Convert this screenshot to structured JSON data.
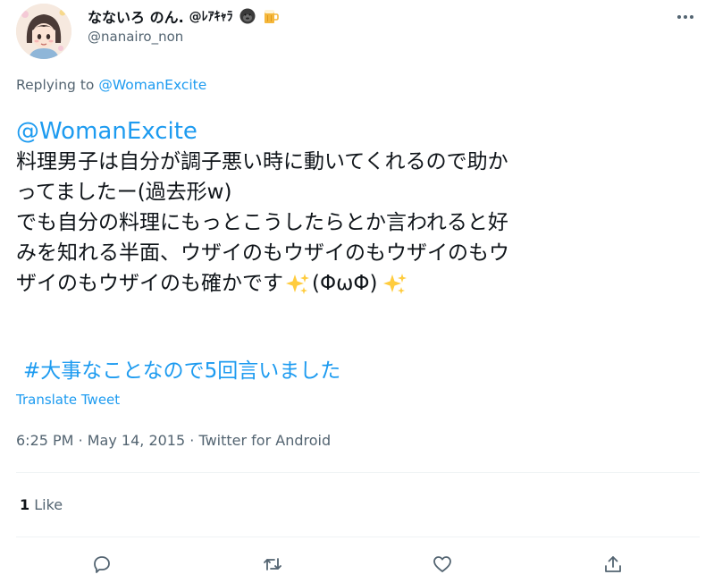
{
  "author": {
    "display_name": "なないろ のん.",
    "name_tail": "@ﾚｱｷｬﾗ",
    "handle": "@nanairo_non"
  },
  "icons": {
    "more": "more-horizontal-icon",
    "emoji_1": "gorilla-emoji-icon",
    "emoji_2": "beer-mug-emoji-icon",
    "sparkles": "sparkles-emoji-icon",
    "reply": "reply-icon",
    "retweet": "retweet-icon",
    "like": "heart-icon",
    "share": "share-icon"
  },
  "replying": {
    "prefix": "Replying to",
    "target": "@WomanExcite"
  },
  "tweet": {
    "mention": "@WomanExcite",
    "lines": [
      "料理男子は自分が調子悪い時に動いてくれるので助か",
      "ってましたー(過去形w)",
      "でも自分の料理にもっとこうしたらとか言われると好",
      "みを知れる半面、ウザイのもウザイのもウザイのもウ",
      "ザイのもウザイのも確かです"
    ],
    "kaomoji": "(ΦωΦ)",
    "hashtag": "#大事なことなので5回言いました"
  },
  "translate_label": "Translate Tweet",
  "meta": {
    "time": "6:25 PM",
    "separator_1": "·",
    "date": "May 14, 2015",
    "separator_2": "·",
    "source": "Twitter for Android"
  },
  "stats": {
    "like_count": "1",
    "like_label": "Like"
  },
  "colors": {
    "link": "#1d9bf0",
    "secondary_text": "#536471",
    "primary_text": "#0f1419",
    "divider": "#eff3f4"
  }
}
